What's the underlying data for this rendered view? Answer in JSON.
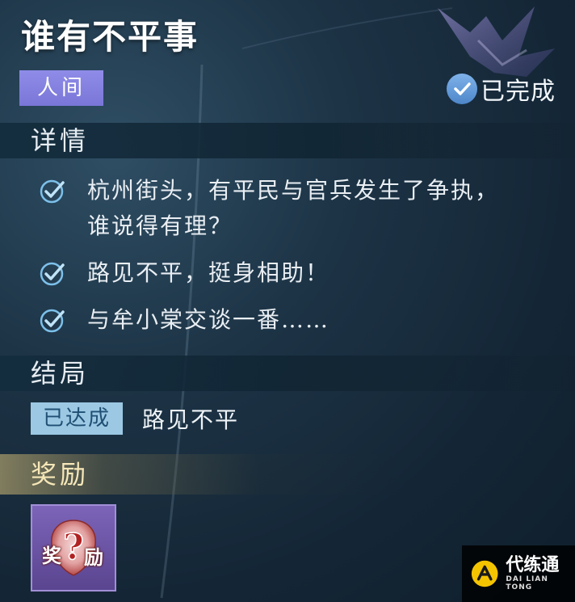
{
  "quest": {
    "title": "谁有不平事",
    "category": "人间",
    "status": "已完成"
  },
  "details": {
    "heading": "详情",
    "items": [
      {
        "line1": "杭州街头，有平民与官兵发生了争执，",
        "line2": "谁说得有理？"
      },
      {
        "line1": "路见不平，挺身相助！",
        "line2": ""
      },
      {
        "line1": "与牟小棠交谈一番……",
        "line2": ""
      }
    ]
  },
  "ending": {
    "heading": "结局",
    "badge": "已达成",
    "text": "路见不平"
  },
  "reward": {
    "heading": "奖励",
    "item_label_left": "奖",
    "item_label_right": "励",
    "item_mark": "?"
  },
  "watermark": {
    "name": "代练通",
    "sub": "DAI LIAN TONG"
  },
  "colors": {
    "category_bg": "#8f8ce8",
    "status_icon": "#5c93d4",
    "check": "#7cc0ea",
    "ending_badge": "#9cc8e3",
    "reward_gold": "#f6e7b8",
    "reward_card": "#6b53a6"
  }
}
